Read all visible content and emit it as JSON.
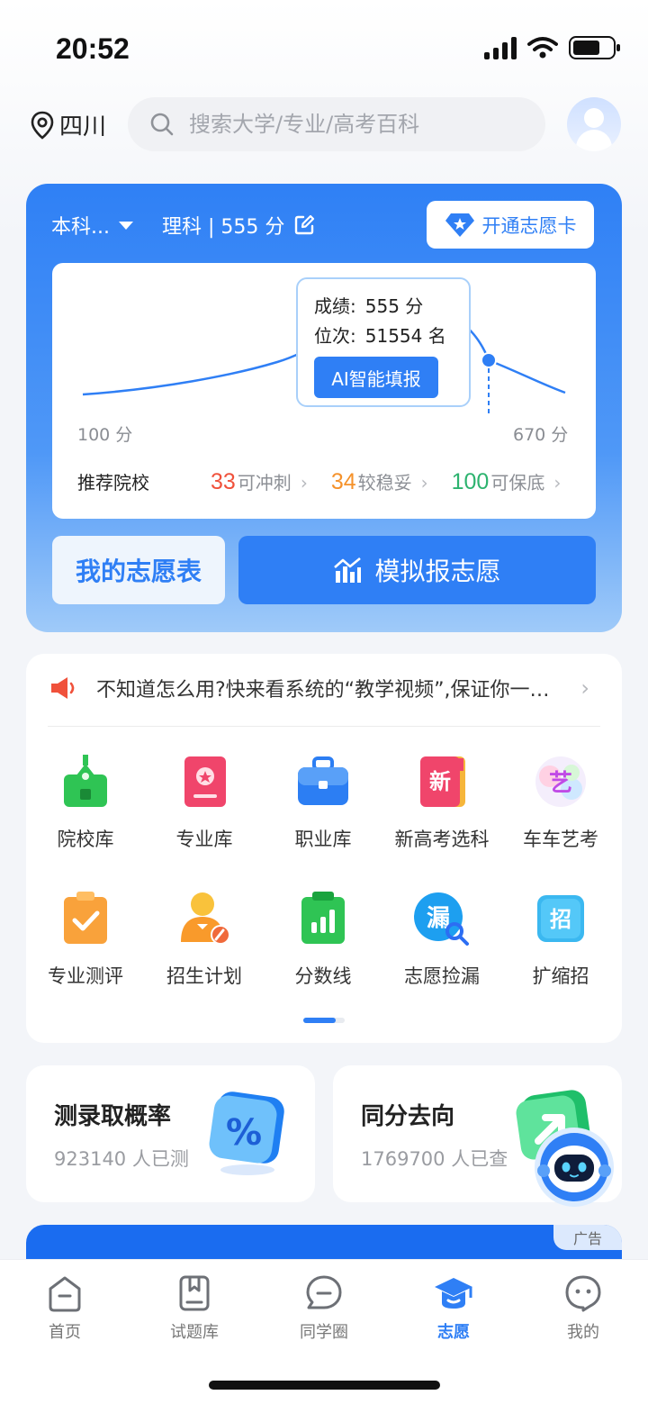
{
  "status": {
    "time": "20:52"
  },
  "header": {
    "location": "四川",
    "search_placeholder": "搜索大学/专业/高考百科"
  },
  "score_card": {
    "batch": "本科...",
    "subject_score": "理科 | 555 分",
    "vip_label": "开通志愿卡",
    "tooltip": {
      "score_label": "成绩:",
      "score_value": "555 分",
      "rank_label": "位次:",
      "rank_value": "51554 名",
      "ai_button": "AI智能填报"
    },
    "axis_min": "100 分",
    "axis_max": "670 分",
    "recommend_title": "推荐院校",
    "recommend": [
      {
        "num": "33",
        "label": "可冲刺",
        "color": "#f0513b"
      },
      {
        "num": "34",
        "label": "较稳妥",
        "color": "#f5922b"
      },
      {
        "num": "100",
        "label": "可保底",
        "color": "#2db36f"
      }
    ],
    "my_table": "我的志愿表",
    "simulate": "模拟报志愿"
  },
  "tools": {
    "notice": "不知道怎么用?快来看系统的“教学视频”,保证你一学就会",
    "items": [
      {
        "label": "院校库",
        "icon": "school-icon"
      },
      {
        "label": "专业库",
        "icon": "major-book-icon"
      },
      {
        "label": "职业库",
        "icon": "briefcase-icon"
      },
      {
        "label": "新高考选科",
        "icon": "new-subject-icon",
        "glyph": "新"
      },
      {
        "label": "车车艺考",
        "icon": "art-exam-icon",
        "glyph": "艺"
      },
      {
        "label": "专业测评",
        "icon": "assessment-icon"
      },
      {
        "label": "招生计划",
        "icon": "enrollment-plan-icon"
      },
      {
        "label": "分数线",
        "icon": "score-line-icon"
      },
      {
        "label": "志愿捡漏",
        "icon": "pick-up-icon",
        "glyph": "漏"
      },
      {
        "label": "扩缩招",
        "icon": "expand-shrink-icon",
        "glyph": "招"
      }
    ]
  },
  "mini_cards": [
    {
      "title": "测录取概率",
      "sub": "923140 人已测"
    },
    {
      "title": "同分去向",
      "sub": "1769700 人已查"
    }
  ],
  "ad": {
    "tag": "广告"
  },
  "tabbar": [
    {
      "label": "首页",
      "icon": "home-icon"
    },
    {
      "label": "试题库",
      "icon": "question-bank-icon"
    },
    {
      "label": "同学圈",
      "icon": "chat-circle-icon"
    },
    {
      "label": "志愿",
      "icon": "graduation-cap-icon"
    },
    {
      "label": "我的",
      "icon": "profile-icon"
    }
  ],
  "colors": {
    "accent": "#2f7ff5"
  }
}
